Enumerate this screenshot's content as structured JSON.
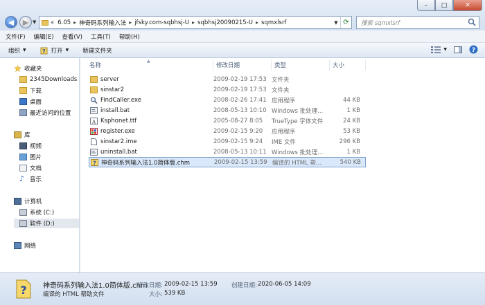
{
  "window": {
    "min_label": "–",
    "max_label": "□",
    "close_label": "✕"
  },
  "address": {
    "prefix": "«",
    "crumbs": [
      "6.05",
      "神奇码系列输入法",
      "jfsky.com-sqbhsj-U",
      "sqbhsj20090215-U",
      "sqmxlsrf"
    ],
    "separator": "▸"
  },
  "search": {
    "placeholder": "搜索 sqmxlsrf"
  },
  "menu": [
    "文件(F)",
    "编辑(E)",
    "查看(V)",
    "工具(T)",
    "帮助(H)"
  ],
  "toolbar": {
    "organize": "组织",
    "open": "打开",
    "new_folder": "新建文件夹"
  },
  "nav": {
    "favorites": "收藏夹",
    "fav_items": [
      "2345Downloads",
      "下载",
      "桌面",
      "最近访问的位置"
    ],
    "libraries": "库",
    "lib_items": [
      "视频",
      "图片",
      "文档",
      "音乐"
    ],
    "computer": "计算机",
    "drives": [
      "系统 (C:)",
      "软件 (D:)"
    ],
    "network": "网络"
  },
  "columns": {
    "name": "名称",
    "date": "修改日期",
    "type": "类型",
    "size": "大小"
  },
  "files": [
    {
      "name": "server",
      "date": "2009-02-19 17:53",
      "type": "文件夹",
      "size": "",
      "icon": "folder"
    },
    {
      "name": "sinstar2",
      "date": "2009-02-19 17:53",
      "type": "文件夹",
      "size": "",
      "icon": "folder"
    },
    {
      "name": "FindCaller.exe",
      "date": "2008-02-26 17:41",
      "type": "应用程序",
      "size": "44 KB",
      "icon": "magnifier"
    },
    {
      "name": "install.bat",
      "date": "2008-05-13 10:10",
      "type": "Windows 批处理...",
      "size": "1 KB",
      "icon": "bat"
    },
    {
      "name": "Ksphonet.ttf",
      "date": "2005-08-27 8:05",
      "type": "TrueType 字体文件",
      "size": "24 KB",
      "icon": "font"
    },
    {
      "name": "register.exe",
      "date": "2009-02-15 9:20",
      "type": "应用程序",
      "size": "53 KB",
      "icon": "register"
    },
    {
      "name": "sinstar2.ime",
      "date": "2009-02-15 9:24",
      "type": "IME 文件",
      "size": "296 KB",
      "icon": "file"
    },
    {
      "name": "uninstall.bat",
      "date": "2008-05-13 10:11",
      "type": "Windows 批处理...",
      "size": "1 KB",
      "icon": "bat"
    },
    {
      "name": "神奇码系列输入法1.0简体版.chm",
      "date": "2009-02-15 13:59",
      "type": "编译的 HTML 帮...",
      "size": "540 KB",
      "icon": "chm"
    }
  ],
  "details": {
    "name": "神奇码系列输入法1.0简体版.chm",
    "type": "编译的 HTML 帮助文件",
    "modified_label": "修改日期:",
    "modified": "2009-02-15 13:59",
    "created_label": "创建日期:",
    "created": "2020-06-05 14:09",
    "size_label": "大小:",
    "size": "539 KB"
  }
}
